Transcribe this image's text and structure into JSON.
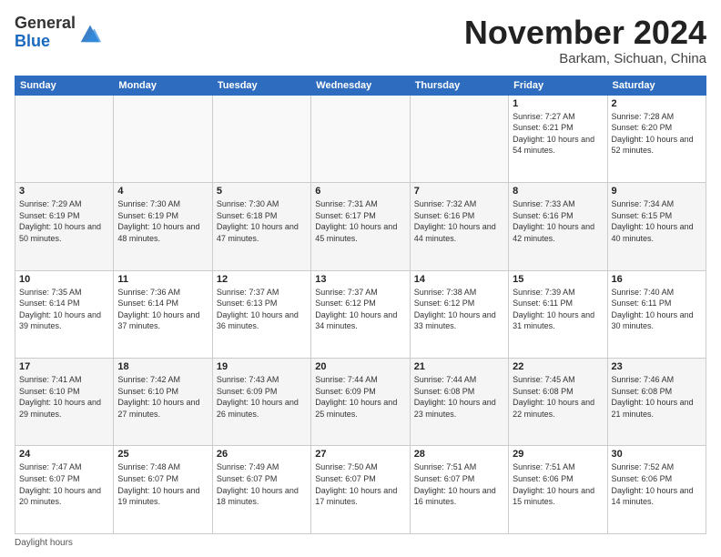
{
  "logo": {
    "line1": "General",
    "line2": "Blue"
  },
  "title": "November 2024",
  "location": "Barkam, Sichuan, China",
  "days_of_week": [
    "Sunday",
    "Monday",
    "Tuesday",
    "Wednesday",
    "Thursday",
    "Friday",
    "Saturday"
  ],
  "weeks": [
    [
      {
        "day": "",
        "info": ""
      },
      {
        "day": "",
        "info": ""
      },
      {
        "day": "",
        "info": ""
      },
      {
        "day": "",
        "info": ""
      },
      {
        "day": "",
        "info": ""
      },
      {
        "day": "1",
        "info": "Sunrise: 7:27 AM\nSunset: 6:21 PM\nDaylight: 10 hours and 54 minutes."
      },
      {
        "day": "2",
        "info": "Sunrise: 7:28 AM\nSunset: 6:20 PM\nDaylight: 10 hours and 52 minutes."
      }
    ],
    [
      {
        "day": "3",
        "info": "Sunrise: 7:29 AM\nSunset: 6:19 PM\nDaylight: 10 hours and 50 minutes."
      },
      {
        "day": "4",
        "info": "Sunrise: 7:30 AM\nSunset: 6:19 PM\nDaylight: 10 hours and 48 minutes."
      },
      {
        "day": "5",
        "info": "Sunrise: 7:30 AM\nSunset: 6:18 PM\nDaylight: 10 hours and 47 minutes."
      },
      {
        "day": "6",
        "info": "Sunrise: 7:31 AM\nSunset: 6:17 PM\nDaylight: 10 hours and 45 minutes."
      },
      {
        "day": "7",
        "info": "Sunrise: 7:32 AM\nSunset: 6:16 PM\nDaylight: 10 hours and 44 minutes."
      },
      {
        "day": "8",
        "info": "Sunrise: 7:33 AM\nSunset: 6:16 PM\nDaylight: 10 hours and 42 minutes."
      },
      {
        "day": "9",
        "info": "Sunrise: 7:34 AM\nSunset: 6:15 PM\nDaylight: 10 hours and 40 minutes."
      }
    ],
    [
      {
        "day": "10",
        "info": "Sunrise: 7:35 AM\nSunset: 6:14 PM\nDaylight: 10 hours and 39 minutes."
      },
      {
        "day": "11",
        "info": "Sunrise: 7:36 AM\nSunset: 6:14 PM\nDaylight: 10 hours and 37 minutes."
      },
      {
        "day": "12",
        "info": "Sunrise: 7:37 AM\nSunset: 6:13 PM\nDaylight: 10 hours and 36 minutes."
      },
      {
        "day": "13",
        "info": "Sunrise: 7:37 AM\nSunset: 6:12 PM\nDaylight: 10 hours and 34 minutes."
      },
      {
        "day": "14",
        "info": "Sunrise: 7:38 AM\nSunset: 6:12 PM\nDaylight: 10 hours and 33 minutes."
      },
      {
        "day": "15",
        "info": "Sunrise: 7:39 AM\nSunset: 6:11 PM\nDaylight: 10 hours and 31 minutes."
      },
      {
        "day": "16",
        "info": "Sunrise: 7:40 AM\nSunset: 6:11 PM\nDaylight: 10 hours and 30 minutes."
      }
    ],
    [
      {
        "day": "17",
        "info": "Sunrise: 7:41 AM\nSunset: 6:10 PM\nDaylight: 10 hours and 29 minutes."
      },
      {
        "day": "18",
        "info": "Sunrise: 7:42 AM\nSunset: 6:10 PM\nDaylight: 10 hours and 27 minutes."
      },
      {
        "day": "19",
        "info": "Sunrise: 7:43 AM\nSunset: 6:09 PM\nDaylight: 10 hours and 26 minutes."
      },
      {
        "day": "20",
        "info": "Sunrise: 7:44 AM\nSunset: 6:09 PM\nDaylight: 10 hours and 25 minutes."
      },
      {
        "day": "21",
        "info": "Sunrise: 7:44 AM\nSunset: 6:08 PM\nDaylight: 10 hours and 23 minutes."
      },
      {
        "day": "22",
        "info": "Sunrise: 7:45 AM\nSunset: 6:08 PM\nDaylight: 10 hours and 22 minutes."
      },
      {
        "day": "23",
        "info": "Sunrise: 7:46 AM\nSunset: 6:08 PM\nDaylight: 10 hours and 21 minutes."
      }
    ],
    [
      {
        "day": "24",
        "info": "Sunrise: 7:47 AM\nSunset: 6:07 PM\nDaylight: 10 hours and 20 minutes."
      },
      {
        "day": "25",
        "info": "Sunrise: 7:48 AM\nSunset: 6:07 PM\nDaylight: 10 hours and 19 minutes."
      },
      {
        "day": "26",
        "info": "Sunrise: 7:49 AM\nSunset: 6:07 PM\nDaylight: 10 hours and 18 minutes."
      },
      {
        "day": "27",
        "info": "Sunrise: 7:50 AM\nSunset: 6:07 PM\nDaylight: 10 hours and 17 minutes."
      },
      {
        "day": "28",
        "info": "Sunrise: 7:51 AM\nSunset: 6:07 PM\nDaylight: 10 hours and 16 minutes."
      },
      {
        "day": "29",
        "info": "Sunrise: 7:51 AM\nSunset: 6:06 PM\nDaylight: 10 hours and 15 minutes."
      },
      {
        "day": "30",
        "info": "Sunrise: 7:52 AM\nSunset: 6:06 PM\nDaylight: 10 hours and 14 minutes."
      }
    ]
  ],
  "footer": "Daylight hours"
}
